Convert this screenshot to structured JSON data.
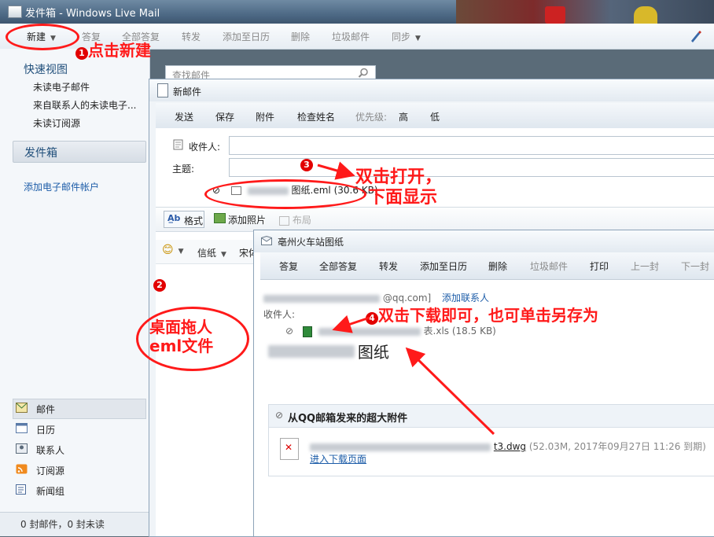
{
  "main": {
    "title": "发件箱 - Windows Live Mail",
    "toolbar": {
      "new": "新建",
      "reply": "答复",
      "reply_all": "全部答复",
      "forward": "转发",
      "add_to_calendar": "添加至日历",
      "delete": "删除",
      "junk": "垃圾邮件",
      "sync": "同步"
    },
    "search_placeholder": "查找邮件",
    "quick_views": {
      "title": "快速视图",
      "items": [
        "未读电子邮件",
        "来自联系人的未读电子...",
        "未读订阅源"
      ]
    },
    "outbox": "发件箱",
    "add_account": "添加电子邮件帐户",
    "nav": [
      "邮件",
      "日历",
      "联系人",
      "订阅源",
      "新闻组"
    ],
    "status": "0 封邮件，0 封未读"
  },
  "compose": {
    "title": "新邮件",
    "toolbar": [
      "发送",
      "保存",
      "附件",
      "检查姓名",
      "优先级:",
      "高",
      "低"
    ],
    "to_label": "收件人:",
    "subject_label": "主题:",
    "attachment": "图纸.eml (30.6 KB)",
    "format_tabs": [
      "格式",
      "添加照片",
      "布局"
    ],
    "emoji": "😊",
    "stationery": "信纸",
    "font_name": "宋体"
  },
  "message": {
    "title": "亳州火车站图纸",
    "toolbar": [
      "答复",
      "全部答复",
      "转发",
      "添加至日历",
      "删除",
      "垃圾邮件",
      "打印",
      "上一封",
      "下一封"
    ],
    "from_suffix": "@qq.com]",
    "add_contact": "添加联系人",
    "to_label": "收件人:",
    "attachment": "表.xls (18.5 KB)",
    "body_text": "图纸",
    "big_attachment_title": "从QQ邮箱发来的超大附件",
    "big_file_name": "t3.dwg",
    "big_file_meta": "(52.03M, 2017年09月27日  11:26 到期)",
    "download_link": "进入下载页面"
  },
  "annotations": {
    "a1": "点击新建",
    "a2_line1": "桌面拖人",
    "a2_line2": "eml文件",
    "a3_line1": "双击打开，",
    "a3_line2": "下面显示",
    "a4": "双击下载即可，也可单击另存为",
    "n1": "1",
    "n2": "2",
    "n3": "3",
    "n4": "4"
  },
  "colors": {
    "annotation": "#ff1a1a",
    "link": "#1c5ca8",
    "heading": "#1f4e7a"
  }
}
